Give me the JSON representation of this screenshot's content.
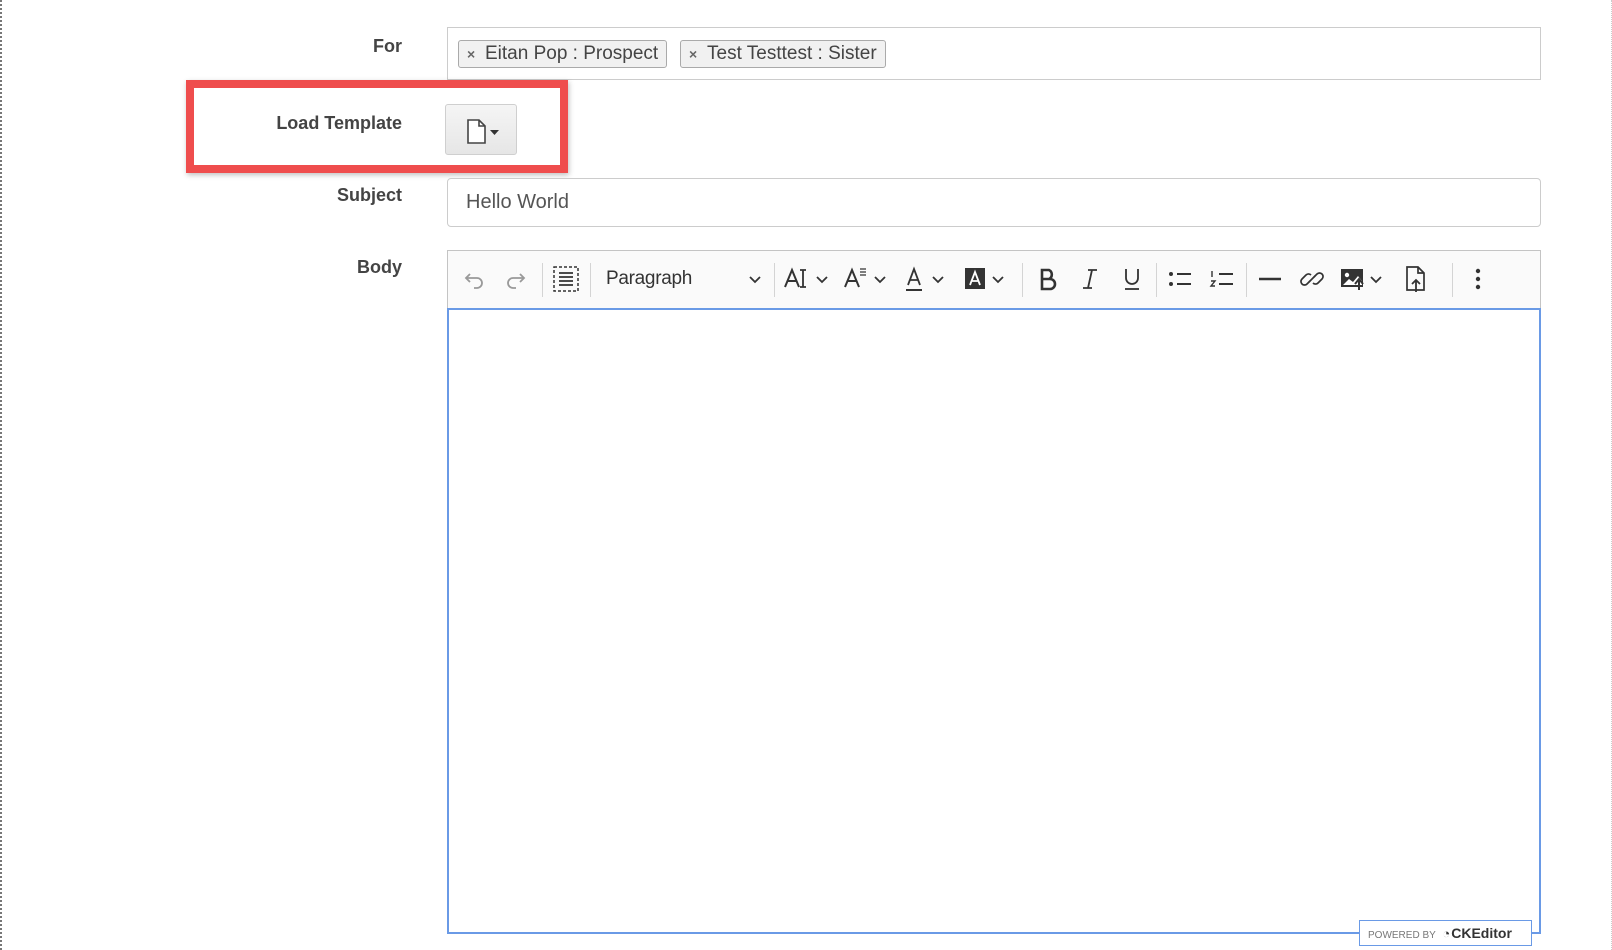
{
  "form": {
    "for_label": "For",
    "recipients": [
      {
        "name": "Eitan Pop : Prospect"
      },
      {
        "name": "Test Testtest : Sister"
      }
    ],
    "load_template_label": "Load Template",
    "subject_label": "Subject",
    "subject_value": "Hello World",
    "body_label": "Body"
  },
  "editor": {
    "heading_select": "Paragraph",
    "powered_by": "POWERED BY",
    "brand": "CKEditor"
  },
  "colors": {
    "highlight": "#ef4d4d",
    "focus_border": "#6a9ae6"
  }
}
